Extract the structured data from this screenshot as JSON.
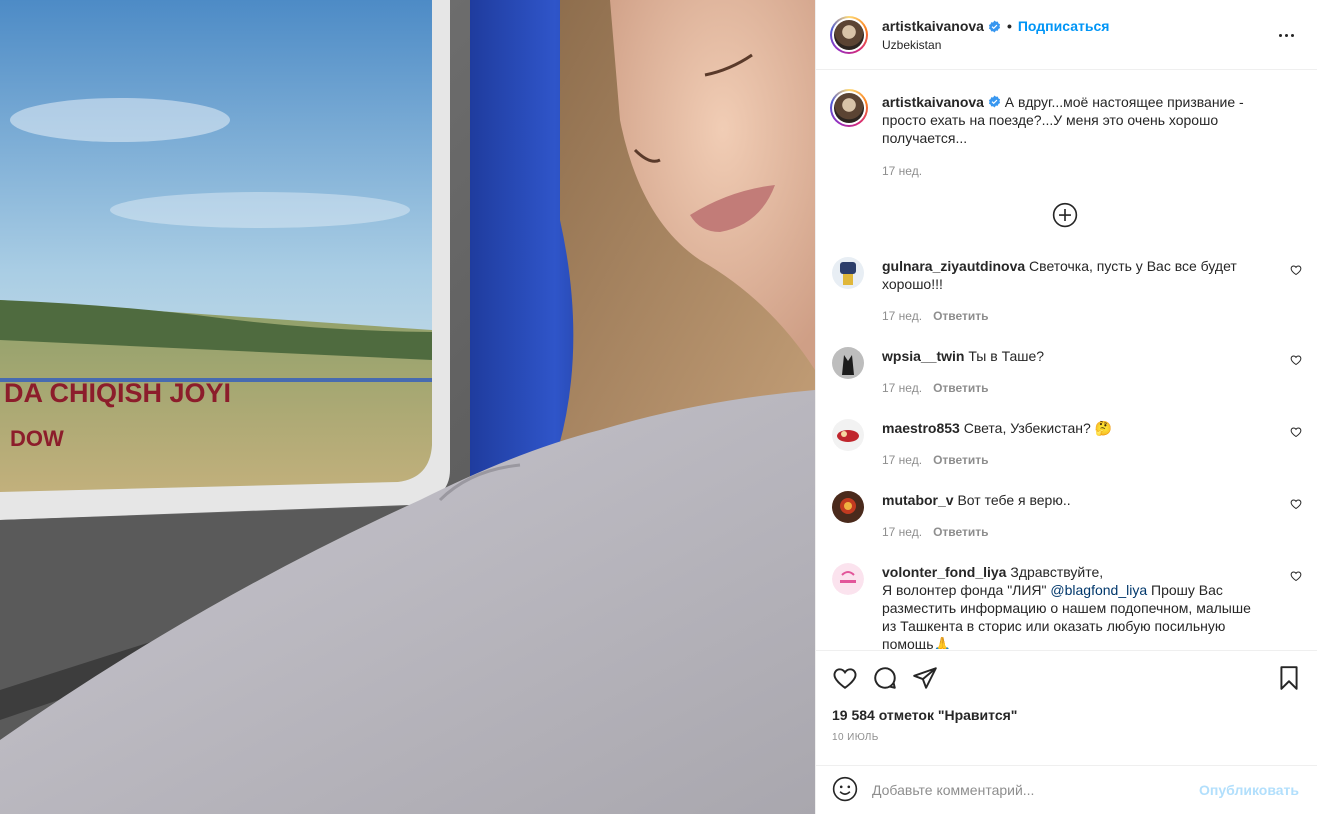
{
  "photo": {
    "window_sign_line1": "DA CHIQISH JOYI",
    "window_sign_line2": "DOW"
  },
  "header": {
    "username": "artistkaivanova",
    "separator": "•",
    "follow_label": "Подписаться",
    "location": "Uzbekistan",
    "more_icon": "more-horizontal-icon"
  },
  "caption": {
    "username": "artistkaivanova",
    "text": "А вдруг...моё настоящее призвание - просто ехать на поезде?...У меня это очень хорошо получается...",
    "time": "17 нед."
  },
  "comments": [
    {
      "username": "gulnara_ziyautdinova",
      "text": "Светочка, пусть у Вас все будет хорошо!!!",
      "time": "17 нед.",
      "reply": "Ответить"
    },
    {
      "username": "wpsia__twin",
      "text": "Ты в Таше?",
      "time": "17 нед.",
      "reply": "Ответить"
    },
    {
      "username": "maestro853",
      "text": "Света, Узбекистан? 🤔",
      "time": "17 нед.",
      "reply": "Ответить"
    },
    {
      "username": "mutabor_v",
      "text": "Вот тебе я верю..",
      "time": "17 нед.",
      "reply": "Ответить"
    },
    {
      "username": "volonter_fond_liya",
      "text_before": "Здравствуйте,\nЯ волонтер фонда \"ЛИЯ\" ",
      "mention": "@blagfond_liya",
      "text_after": " Прошу Вас разместить информацию о нашем подопечном, малыше из Ташкента в сторис или оказать любую посильную помощь🙏"
    }
  ],
  "actions": {
    "likes": "19 584 отметок \"Нравится\"",
    "date": "10 ИЮЛЬ"
  },
  "add_comment": {
    "placeholder": "Добавьте комментарий...",
    "post_label": "Опубликовать"
  },
  "colors": {
    "link": "#0095f6",
    "text": "#262626",
    "muted": "#8e8e8e",
    "border": "#efefef",
    "post_disabled": "#b2dffc"
  }
}
